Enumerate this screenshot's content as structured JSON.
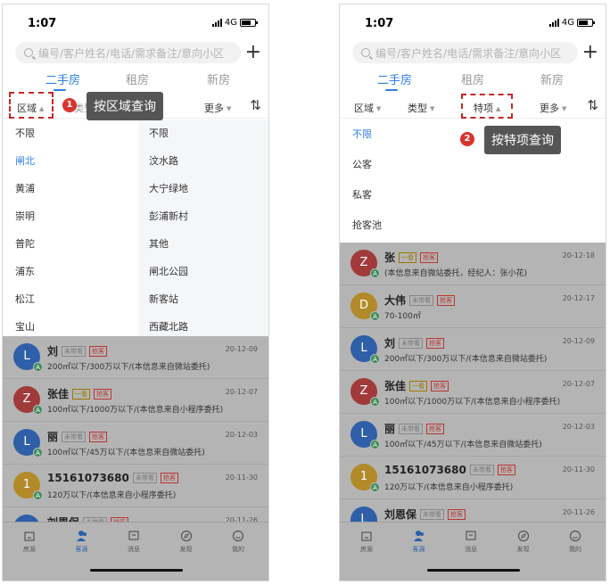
{
  "left": {
    "time": "1:07",
    "network": "4G",
    "search_placeholder": "编号/客户姓名/电话/需求备注/意向小区",
    "tabs": [
      "二手房",
      "租房",
      "新房"
    ],
    "filters": [
      "区域",
      "更多"
    ],
    "filter_partial": "类型",
    "callout": "按区域查询",
    "callout_num": "1",
    "districts": [
      "不限",
      "闸北",
      "黄浦",
      "崇明",
      "普陀",
      "浦东",
      "松江",
      "宝山"
    ],
    "subdistricts": [
      "不限",
      "汶水路",
      "大宁绿地",
      "彭浦新村",
      "其他",
      "闸北公园",
      "新客站",
      "西藏北路"
    ],
    "rows": [
      {
        "initial": "L",
        "name": "刘",
        "tags": [
          "未带看",
          "抢客"
        ],
        "desc": "200㎡以下/300万以下/(本信息来自微站委托)",
        "date": "20-12-09",
        "color": "#2f5fa8"
      },
      {
        "initial": "Z",
        "name": "张佳",
        "tags": [
          "一看",
          "抢客"
        ],
        "desc": "100㎡以下/1000万以下/(本信息来自小程序委托)",
        "date": "20-12-07",
        "color": "#a13a3a"
      },
      {
        "initial": "L",
        "name": "丽",
        "tags": [
          "未带看",
          "抢客"
        ],
        "desc": "100㎡以下/45万以下/(本信息来自微站委托)",
        "date": "20-12-03",
        "color": "#2f5fa8"
      },
      {
        "initial": "1",
        "name": "15161073680",
        "tags": [
          "未带看",
          "抢客"
        ],
        "desc": "120万以下/(本信息来自小程序委托)",
        "date": "20-11-30",
        "color": "#b38a2a"
      },
      {
        "initial": "L",
        "name": "刘恩保",
        "tags": [
          "未带看",
          "抢客"
        ],
        "desc": "",
        "date": "20-11-26",
        "color": "#2f5fa8"
      }
    ]
  },
  "right": {
    "time": "1:07",
    "network": "4G",
    "search_placeholder": "编号/客户姓名/电话/需求备注/意向小区",
    "tabs": [
      "二手房",
      "租房",
      "新房"
    ],
    "filters": [
      "区域",
      "类型",
      "特项",
      "更多"
    ],
    "callout": "按特项查询",
    "callout_num": "2",
    "special_options": [
      "不限",
      "公客",
      "私客",
      "抢客池"
    ],
    "rows": [
      {
        "initial": "Z",
        "name": "张",
        "tags": [
          "一看",
          "抢客"
        ],
        "desc": "(本信息来自微站委托，经纪人：张小花)",
        "date": "20-12-18",
        "color": "#a13a3a"
      },
      {
        "initial": "D",
        "name": "大伟",
        "tags": [
          "未带看",
          "抢客"
        ],
        "desc": "70-100㎡",
        "date": "20-12-17",
        "color": "#b38a2a"
      },
      {
        "initial": "L",
        "name": "刘",
        "tags": [
          "未带看",
          "抢客"
        ],
        "desc": "200㎡以下/300万以下/(本信息来自微站委托)",
        "date": "20-12-09",
        "color": "#2f5fa8"
      },
      {
        "initial": "Z",
        "name": "张佳",
        "tags": [
          "一看",
          "抢客"
        ],
        "desc": "100㎡以下/1000万以下/(本信息来自小程序委托)",
        "date": "20-12-07",
        "color": "#a13a3a"
      },
      {
        "initial": "L",
        "name": "丽",
        "tags": [
          "未带看",
          "抢客"
        ],
        "desc": "100㎡以下/45万以下/(本信息来自微站委托)",
        "date": "20-12-03",
        "color": "#2f5fa8"
      },
      {
        "initial": "1",
        "name": "15161073680",
        "tags": [
          "未带看",
          "抢客"
        ],
        "desc": "120万以下/(本信息来自小程序委托)",
        "date": "20-11-30",
        "color": "#b38a2a"
      },
      {
        "initial": "L",
        "name": "刘恩保",
        "tags": [
          "未带看",
          "抢客"
        ],
        "desc": "",
        "date": "20-11-26",
        "color": "#2f5fa8"
      }
    ]
  },
  "bottom_nav": [
    {
      "label": "房源",
      "icon": "house-icon"
    },
    {
      "label": "客源",
      "icon": "people-icon"
    },
    {
      "label": "消息",
      "icon": "message-icon"
    },
    {
      "label": "发现",
      "icon": "compass-icon"
    },
    {
      "label": "我的",
      "icon": "smiley-icon"
    }
  ],
  "accent_color": "#2f7fe6"
}
